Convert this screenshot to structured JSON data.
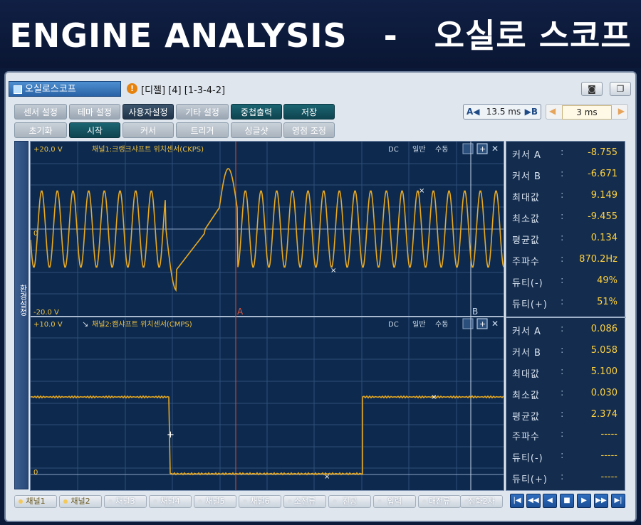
{
  "banner": {
    "title": "ENGINE ANALYSIS   -   오실로 스코프"
  },
  "window": {
    "tab_label": "오실로스코프",
    "vehicle_info": "[디젤] [4] [1-3-4-2]",
    "camera_icon": "camera-icon",
    "window_icon": "window-icon"
  },
  "toolbar": {
    "row1": [
      "센서 설정",
      "테마 설정",
      "사용자설정",
      "기타 설정",
      "중첩출력",
      "저장"
    ],
    "row2": [
      "초기화",
      "시작",
      "커서",
      "트리거",
      "싱글샷",
      "영점 조정"
    ],
    "cursor_a": "A",
    "cursor_b": "B",
    "cursor_delta": "13.5 ms",
    "time_div": "3 ms"
  },
  "side_label": "환경설정",
  "channel1": {
    "top_label": "+20.0 V",
    "zero_label": "0",
    "bottom_label": "-20.0 V",
    "name": "채널1:크랭크샤프트 위치센서(CKPS)",
    "coupling": "DC",
    "mode": "일반",
    "trigger": "수동",
    "marker_a": "A",
    "marker_b": "B",
    "color": "#e8a922",
    "stats": [
      {
        "label": "커서 A",
        "value": "-8.755"
      },
      {
        "label": "커서 B",
        "value": "-6.671"
      },
      {
        "label": "최대값",
        "value": "9.149"
      },
      {
        "label": "최소값",
        "value": "-9.455"
      },
      {
        "label": "평균값",
        "value": "0.134"
      },
      {
        "label": "주파수",
        "value": "870.2Hz"
      },
      {
        "label": "듀티(-)",
        "value": "49%"
      },
      {
        "label": "듀티(+)",
        "value": "51%"
      }
    ]
  },
  "channel2": {
    "top_label": "+10.0 V",
    "zero_label": "0",
    "name": "채널2:캠샤프트 위치센서(CMPS)",
    "coupling": "DC",
    "mode": "일반",
    "trigger": "수동",
    "color": "#e8a922",
    "stats": [
      {
        "label": "커서 A",
        "value": "0.086"
      },
      {
        "label": "커서 B",
        "value": "5.058"
      },
      {
        "label": "최대값",
        "value": "5.100"
      },
      {
        "label": "최소값",
        "value": "0.030"
      },
      {
        "label": "평균값",
        "value": "2.374"
      },
      {
        "label": "주파수",
        "value": "-----"
      },
      {
        "label": "듀티(-)",
        "value": "-----"
      },
      {
        "label": "듀티(+)",
        "value": "-----"
      }
    ]
  },
  "channels_bar": [
    "채널1",
    "채널2",
    "채널3",
    "채널4",
    "채널5",
    "채널6",
    "소전류",
    "진공",
    "압력",
    "대전류",
    "점화2차"
  ],
  "channels_on": [
    true,
    true,
    false,
    false,
    false,
    false,
    false,
    false,
    false,
    false,
    false
  ],
  "playback_icons": [
    "skip-start-icon",
    "rewind-icon",
    "prev-icon",
    "stop-icon",
    "play-icon",
    "fast-forward-icon",
    "skip-end-icon"
  ]
}
